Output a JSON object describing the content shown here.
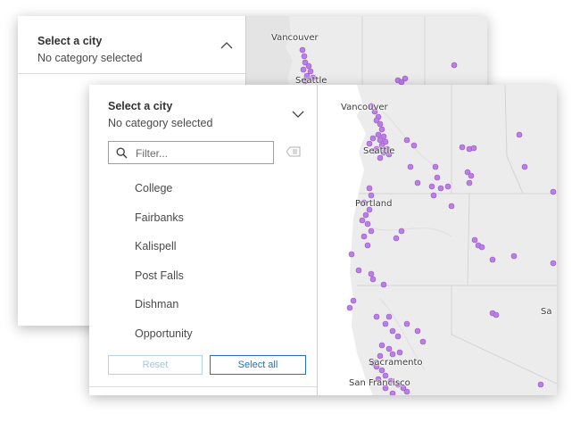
{
  "back_widget": {
    "title": "Select a city",
    "subtitle": "No category selected",
    "map_labels": [
      "Vancouver",
      "Seattle"
    ]
  },
  "front_widget": {
    "title": "Select a city",
    "subtitle": "No category selected",
    "filter": {
      "placeholder": "Filter..."
    },
    "cities": [
      "College",
      "Fairbanks",
      "Kalispell",
      "Post Falls",
      "Dishman",
      "Opportunity"
    ],
    "buttons": {
      "reset": "Reset",
      "select_all": "Select all"
    },
    "map_labels": {
      "vancouver": "Vancouver",
      "seattle": "Seattle",
      "portland": "Portland",
      "sacramento": "Sacramento",
      "san_francisco": "San Francisco",
      "sa": "Sa"
    }
  },
  "colors": {
    "point": "#b97fe3",
    "point_stroke": "#9b55d0",
    "land": "#ececec",
    "water": "#ffffff",
    "accent": "#1f70c1"
  }
}
